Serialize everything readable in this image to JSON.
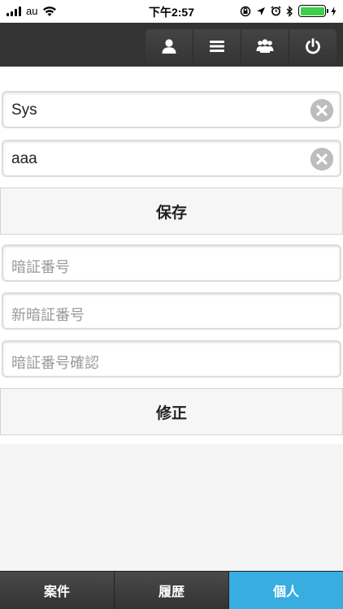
{
  "status_bar": {
    "carrier": "au",
    "time": "下午2:57",
    "battery_color": "#3fcf4a"
  },
  "toolbar": {
    "buttons": [
      {
        "icon": "user-icon"
      },
      {
        "icon": "menu-icon"
      },
      {
        "icon": "group-icon"
      },
      {
        "icon": "power-icon"
      }
    ]
  },
  "form": {
    "username": {
      "value": "Sys",
      "clear_icon": "clear-icon"
    },
    "name": {
      "value": "aaa",
      "clear_icon": "clear-icon"
    },
    "save_label": "保存",
    "password": {
      "placeholder": "暗証番号"
    },
    "new_password": {
      "placeholder": "新暗証番号"
    },
    "confirm_password": {
      "placeholder": "暗証番号確認"
    },
    "modify_label": "修正"
  },
  "tabs": [
    {
      "label": "案件",
      "active": false
    },
    {
      "label": "履歴",
      "active": false
    },
    {
      "label": "個人",
      "active": true
    }
  ],
  "colors": {
    "accent": "#38aee0",
    "header": "#333333"
  }
}
